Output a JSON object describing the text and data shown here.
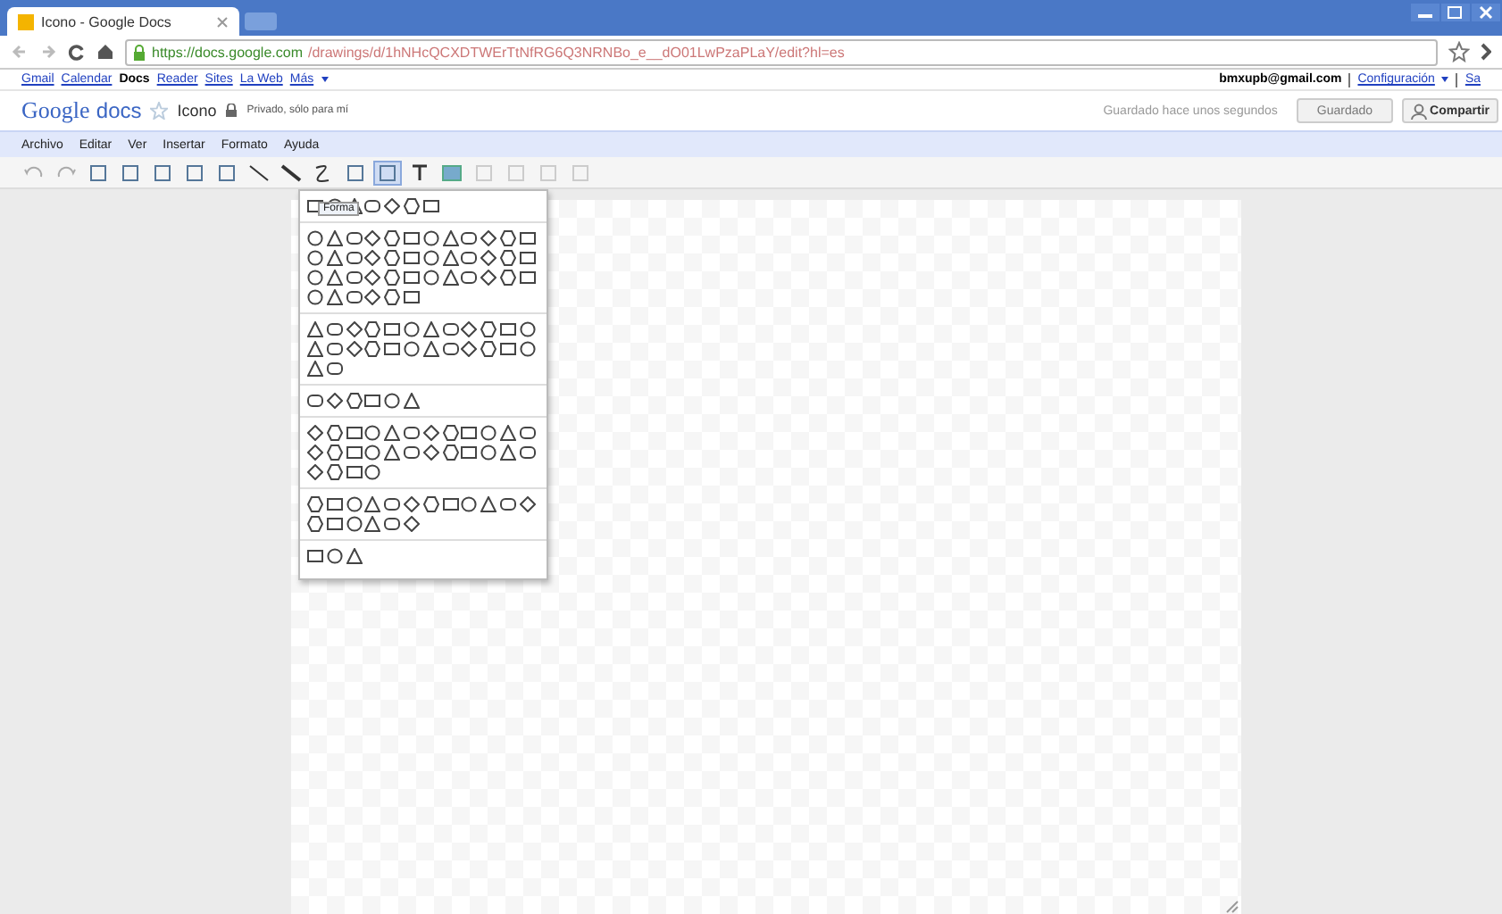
{
  "browser": {
    "tab_title": "Icono - Google Docs",
    "url_host": "https://docs.google.com",
    "url_path": "/drawings/d/1hNHcQCXDTWErTtNfRG6Q3NRNBo_e__dO01LwPzaPLaY/edit?hl=es"
  },
  "gbar": {
    "links": [
      {
        "label": "Gmail",
        "selected": false
      },
      {
        "label": "Calendar",
        "selected": false
      },
      {
        "label": "Docs",
        "selected": true
      },
      {
        "label": "Reader",
        "selected": false
      },
      {
        "label": "Sites",
        "selected": false
      },
      {
        "label": "La Web",
        "selected": false
      },
      {
        "label": "Más",
        "selected": false
      }
    ],
    "account": "bmxupb@gmail.com",
    "settings": "Configuración",
    "signout": "Sa"
  },
  "header": {
    "logo_google": "Google",
    "logo_docs": "docs",
    "title": "Icono",
    "privacy": "Privado, sólo para mí",
    "save_status": "Guardado hace unos segundos",
    "saved_button": "Guardado",
    "share_button": "Compartir"
  },
  "menu": [
    "Archivo",
    "Editar",
    "Ver",
    "Insertar",
    "Formato",
    "Ayuda"
  ],
  "shape_menu": {
    "tooltip": "Forma"
  }
}
